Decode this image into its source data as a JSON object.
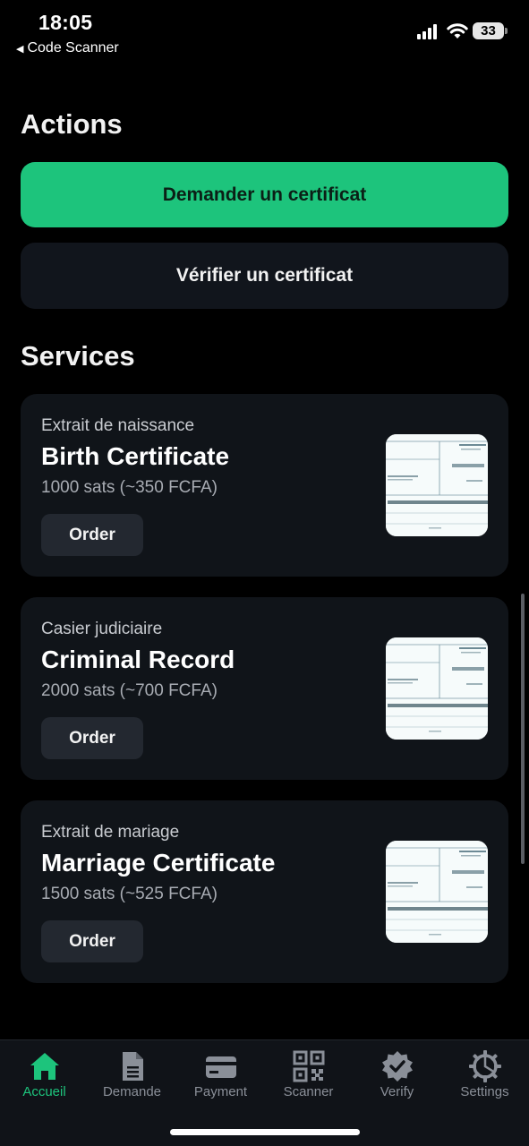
{
  "status_bar": {
    "time": "18:05",
    "back_label": "Code Scanner",
    "battery": "33"
  },
  "actions": {
    "title": "Actions",
    "request_button": "Demander un certificat",
    "verify_button": "Vérifier un certificat"
  },
  "services": {
    "title": "Services",
    "items": [
      {
        "subtitle": "Extrait de naissance",
        "title": "Birth Certificate",
        "price": "1000 sats (~350 FCFA)",
        "button": "Order"
      },
      {
        "subtitle": "Casier judiciaire",
        "title": "Criminal Record",
        "price": "2000 sats (~700 FCFA)",
        "button": "Order"
      },
      {
        "subtitle": "Extrait de mariage",
        "title": "Marriage Certificate",
        "price": "1500 sats (~525 FCFA)",
        "button": "Order"
      }
    ]
  },
  "tab_bar": {
    "accent_color": "#1dc47c",
    "items": [
      {
        "label": "Accueil",
        "icon": "home-icon",
        "active": true
      },
      {
        "label": "Demande",
        "icon": "document-icon",
        "active": false
      },
      {
        "label": "Payment",
        "icon": "credit-card-icon",
        "active": false
      },
      {
        "label": "Scanner",
        "icon": "qr-code-icon",
        "active": false
      },
      {
        "label": "Verify",
        "icon": "verified-badge-icon",
        "active": false
      },
      {
        "label": "Settings",
        "icon": "gear-icon",
        "active": false
      }
    ]
  }
}
